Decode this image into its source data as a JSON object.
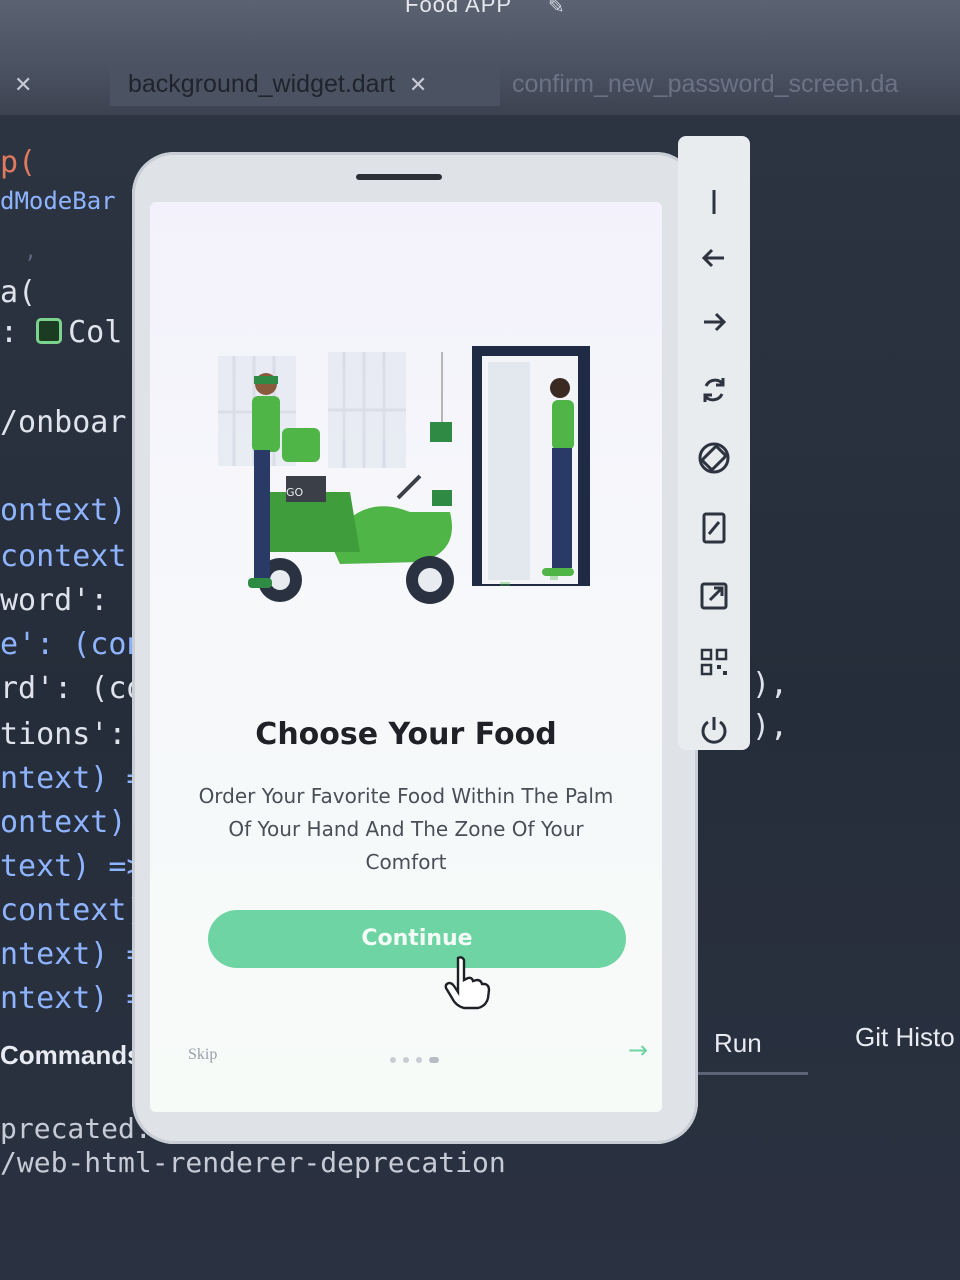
{
  "ide": {
    "window_title": "Food APP",
    "tabs": [
      {
        "label": "",
        "active": false
      },
      {
        "label": "background_widget.dart",
        "active": true
      },
      {
        "label": "confirm_new_password_screen.da",
        "active": false
      }
    ],
    "code_lines": [
      "p(",
      "dModeBar",
      ",",
      "a(",
      ":",
      "Col",
      "/onboar",
      "ontext)",
      "context",
      "word': (",
      "e': (con",
      "rd': (co",
      "tions':",
      "ntext) =",
      "ontext) :",
      "text) =>",
      "context)",
      "ntext) =",
      "ntext) =",
      "),",
      "),"
    ],
    "panel_commands": "Commands",
    "panel_run": "Run",
    "panel_git": "Git Histo",
    "console_line_1": "precated. S",
    "console_line_2": "/web-html-renderer-deprecation"
  },
  "onboarding": {
    "title": "Choose Your Food",
    "description_line1": "Order Your Favorite Food Within The Palm",
    "description_line2": "Of Your Hand And The Zone Of Your",
    "description_line3": "Comfort",
    "continue_label": "Continue",
    "skip_label": "Skip",
    "page_indicator": {
      "pages": 4,
      "active": 4
    },
    "illustration_sign": "GO",
    "accent_color": "#6fd4a4",
    "illustration_icons": [
      "delivery-person-icon",
      "scooter-icon",
      "customer-icon",
      "door-icon",
      "windows-icon",
      "food-bag-icon"
    ]
  },
  "emulator_toolbar": {
    "buttons": [
      {
        "icon": "minimize-icon"
      },
      {
        "icon": "back-arrow-icon"
      },
      {
        "icon": "forward-arrow-icon"
      },
      {
        "icon": "refresh-icon"
      },
      {
        "icon": "rotate-icon"
      },
      {
        "icon": "edit-device-icon"
      },
      {
        "icon": "open-external-icon"
      },
      {
        "icon": "qr-code-icon"
      },
      {
        "icon": "power-icon"
      }
    ]
  }
}
